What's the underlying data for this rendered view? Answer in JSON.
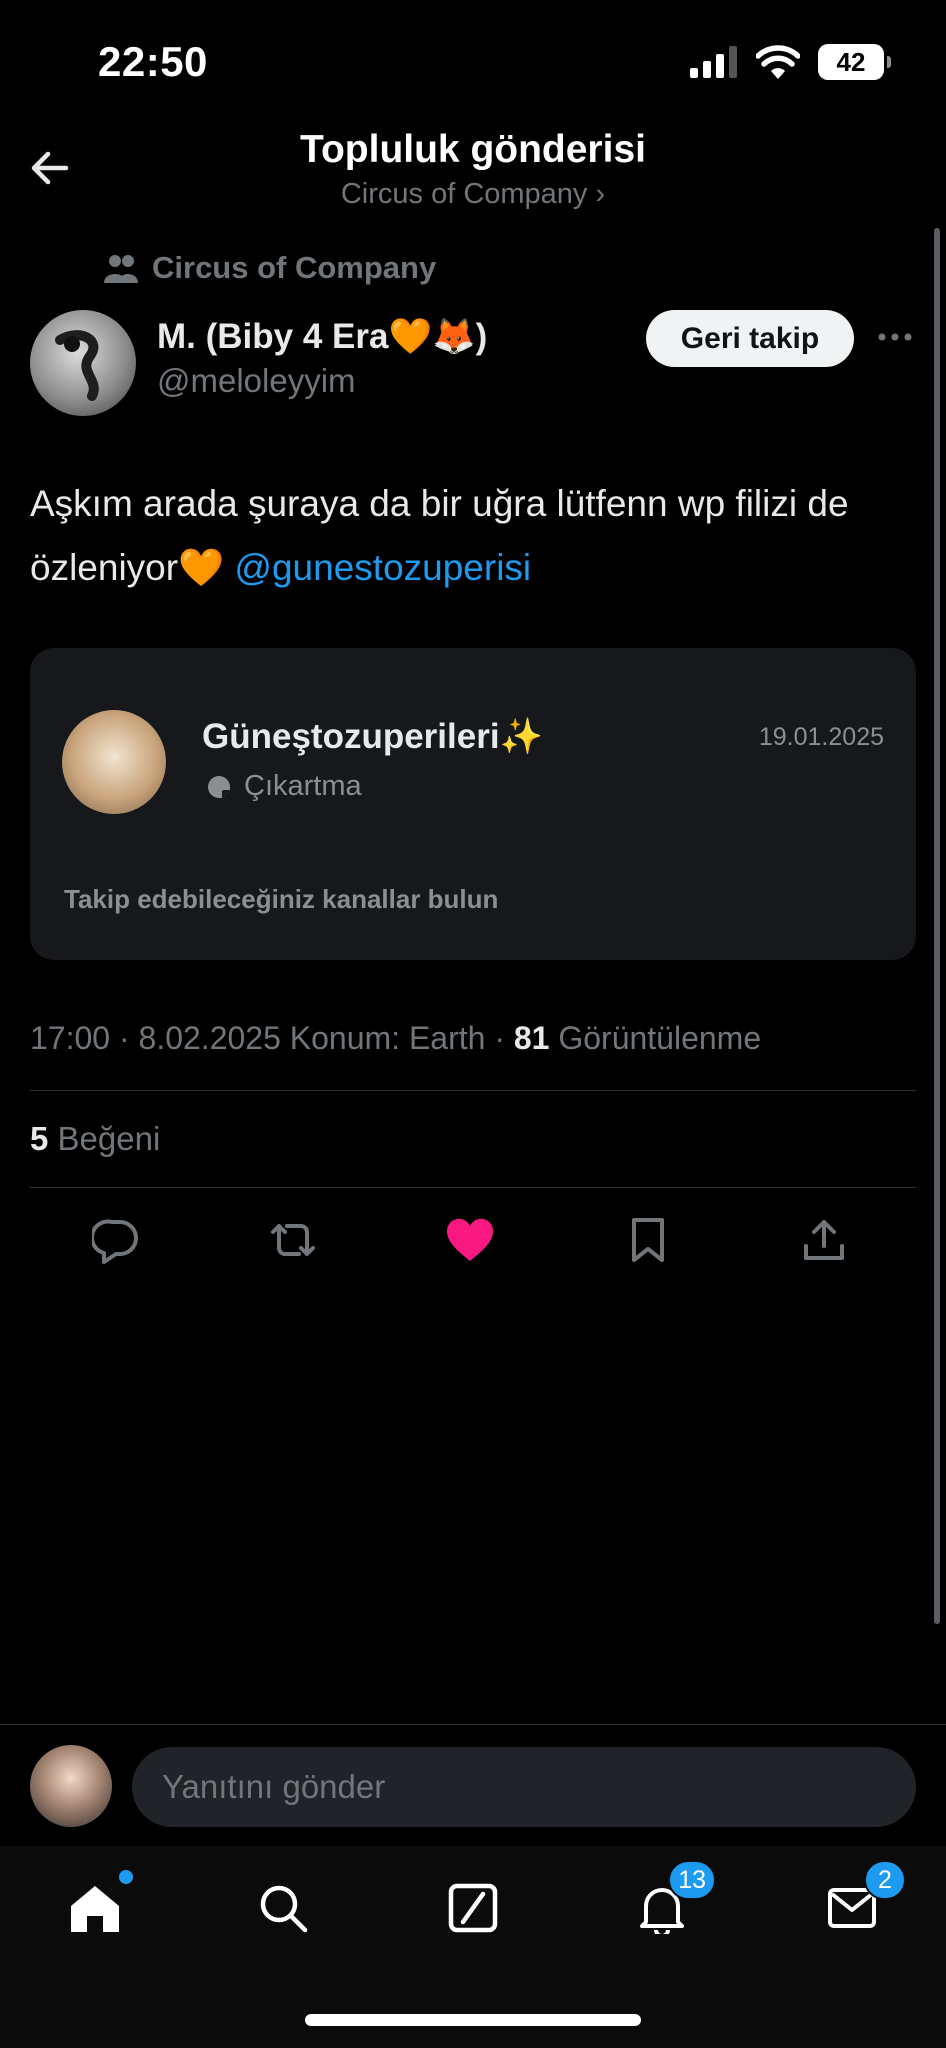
{
  "status_bar": {
    "time": "22:50",
    "battery": "42"
  },
  "header": {
    "title": "Topluluk gönderisi",
    "subtitle": "Circus of Company ›"
  },
  "post": {
    "community": "Circus of Company",
    "author_name": "M. (Biby 4 Era🧡🦊)",
    "author_handle": "@meloleyyim",
    "follow_label": "Geri takip",
    "text": "Aşkım arada şuraya da bir uğra lütfenn wp filizi de özleniyor🧡 ",
    "mention": "@gunestozuperisi",
    "card": {
      "name": "Güneştozuperileri✨",
      "date": "19.01.2025",
      "meta": "Çıkartma",
      "footer": "Takip edebileceğiniz kanallar bulun"
    },
    "time": "17:00",
    "date": "8.02.2025",
    "location": "Konum: Earth",
    "views_count": "81",
    "views_label": "Görüntülenme",
    "likes_count": "5",
    "likes_label": "Beğeni"
  },
  "reply": {
    "placeholder": "Yanıtını gönder"
  },
  "tabbar": {
    "notifications_badge": "13",
    "messages_badge": "2"
  },
  "colors": {
    "accent": "#1d9bf0",
    "like": "#f91880",
    "muted": "#71767b"
  }
}
